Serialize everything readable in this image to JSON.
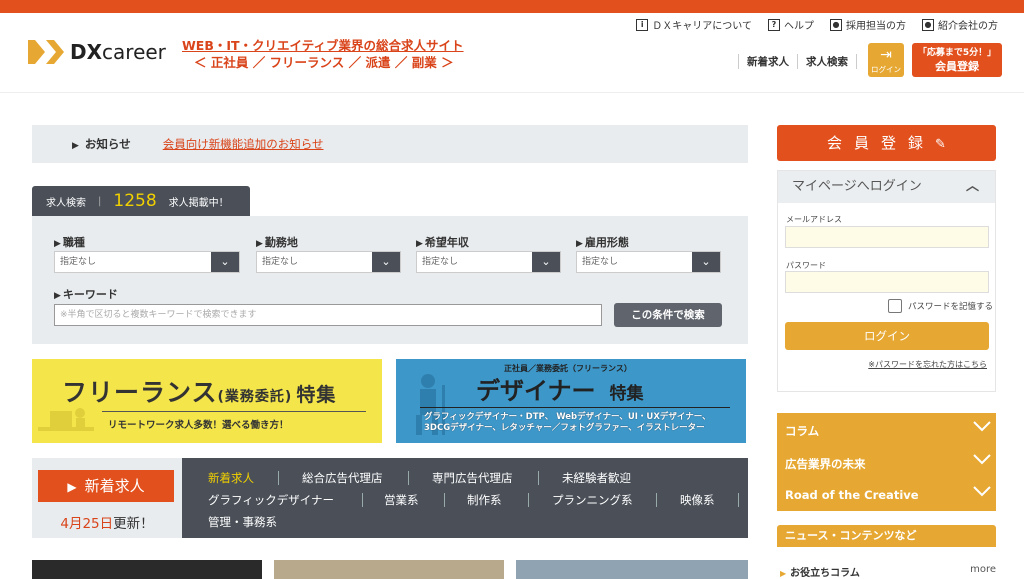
{
  "colors": {
    "brand": "#e2501d",
    "accent": "#e6a833",
    "dark": "#4a4f58",
    "highlight": "#f1d000"
  },
  "header": {
    "logo_text_bold": "DX",
    "logo_text": "career",
    "tagline_line1": "WEB・IT・クリエイティブ業界の総合求人サイト",
    "tagline_line2": "＜ 正社員 ／ フリーランス ／ 派遣 ／ 副業 ＞",
    "util_links": [
      {
        "label": "ＤＸキャリアについて",
        "icon": "info-icon"
      },
      {
        "label": "ヘルプ",
        "icon": "help-icon"
      },
      {
        "label": "採用担当の方",
        "icon": "person-icon"
      },
      {
        "label": "紹介会社の方",
        "icon": "person-icon"
      }
    ],
    "nav": [
      "新着求人",
      "求人検索"
    ],
    "login_label": "ログイン",
    "register_small": "「応募まで5分！」",
    "register_label": "会員登録"
  },
  "notice": {
    "label": "お知らせ",
    "link": "会員向け新機能追加のお知らせ"
  },
  "search": {
    "tab_label": "求人検索",
    "count": "1258",
    "count_suffix": "求人掲載中！",
    "fields": [
      {
        "label": "職種",
        "value": "指定なし"
      },
      {
        "label": "勤務地",
        "value": "指定なし"
      },
      {
        "label": "希望年収",
        "value": "指定なし"
      },
      {
        "label": "雇用形態",
        "value": "指定なし"
      }
    ],
    "keyword_label": "キーワード",
    "keyword_placeholder": "※半角で区切ると複数キーワードで検索できます",
    "submit": "この条件で検索"
  },
  "banners": {
    "freelance": {
      "title": "フリーランス",
      "paren": "(業務委託)",
      "feature": "特集",
      "sub": "リモートワーク求人多数！選べる働き方！"
    },
    "designer": {
      "tiny": "正社員／業務委託（フリーランス）",
      "title": "デザイナー",
      "feature": "特集",
      "desc1": "グラフィックデザイナー・DTP、 Webデザイナー、UI・UXデザイナー、",
      "desc2": "3DCGデザイナー、レタッチャー／フォトグラファー、イラストレーター"
    }
  },
  "new_jobs": {
    "button": "新着求人",
    "date": "4月25日",
    "date_suffix": "更新！",
    "categories": [
      "新着求人",
      "総合広告代理店",
      "専門広告代理店",
      "未経験者歓迎",
      "グラフィックデザイナー",
      "営業系",
      "制作系",
      "プランニング系",
      "映像系",
      "管理・事務系"
    ]
  },
  "sidebar": {
    "register": "会員登録",
    "login_head": "マイページへログイン",
    "email_label": "メールアドレス",
    "password_label": "パスワード",
    "remember": "パスワードを記憶する",
    "login_button": "ログイン",
    "forgot": "※パスワードを忘れた方はこちら",
    "accordion": [
      "コラム",
      "広告業界の未来",
      "Road of the Creative"
    ],
    "news_head": "ニュース・コンテンツなど",
    "news_item": "お役立ちコラム",
    "more": "more"
  }
}
